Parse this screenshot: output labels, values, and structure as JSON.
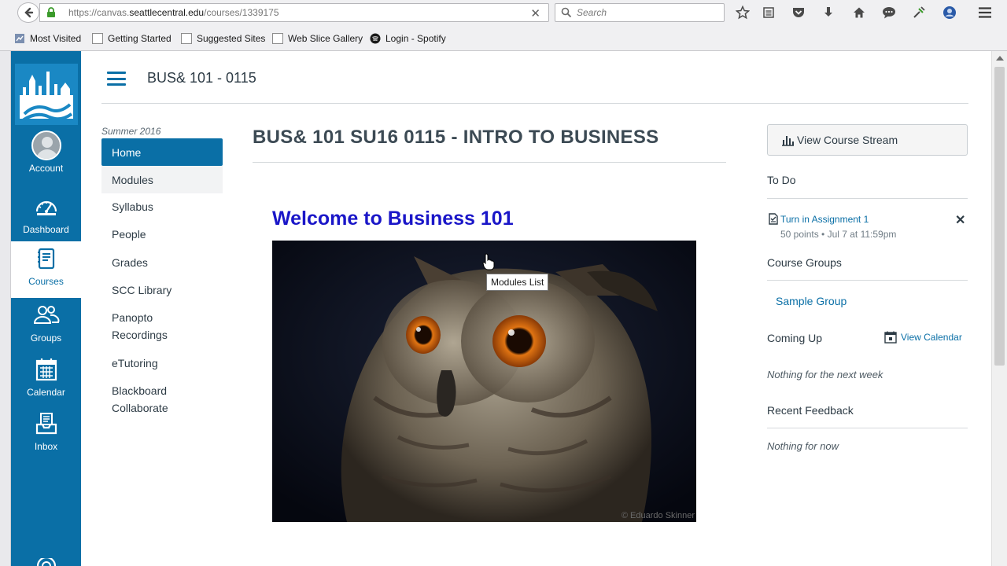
{
  "browser": {
    "url_prefix": "https://canvas.",
    "url_domain": "seattlecentral.edu",
    "url_path": "/courses/1339175",
    "search_placeholder": "Search",
    "bookmarks": [
      {
        "label": "Most Visited"
      },
      {
        "label": "Getting Started"
      },
      {
        "label": "Suggested Sites"
      },
      {
        "label": "Web Slice Gallery"
      },
      {
        "label": "Login - Spotify"
      }
    ]
  },
  "global_nav": {
    "items": [
      {
        "label": "Account",
        "icon": "avatar"
      },
      {
        "label": "Dashboard",
        "icon": "dashboard-icon"
      },
      {
        "label": "Courses",
        "icon": "courses-icon",
        "active": true
      },
      {
        "label": "Groups",
        "icon": "groups-icon"
      },
      {
        "label": "Calendar",
        "icon": "calendar-icon"
      },
      {
        "label": "Inbox",
        "icon": "inbox-icon"
      }
    ],
    "accent": "#0a6fa6"
  },
  "header": {
    "course_crumb": "BUS& 101 - 0115"
  },
  "course_nav": {
    "term": "Summer 2016",
    "items": [
      {
        "label": "Home"
      },
      {
        "label": "Modules"
      },
      {
        "label": "Syllabus"
      },
      {
        "label": "People"
      },
      {
        "label": "Grades"
      },
      {
        "label": "SCC Library"
      },
      {
        "label": "Panopto\nRecordings"
      },
      {
        "label": "eTutoring"
      },
      {
        "label": "Blackboard\nCollaborate"
      }
    ]
  },
  "main": {
    "course_title": "BUS& 101 SU16 0115 - INTRO TO BUSINESS",
    "welcome": "Welcome to Business 101",
    "image_credit": "© Eduardo Skinner",
    "tooltip": "Modules List"
  },
  "sidebar": {
    "stream_button": "View Course Stream",
    "todo_heading": "To Do",
    "todo_item": {
      "title": "Turn in Assignment 1",
      "meta": "50 points • Jul 7 at 11:59pm"
    },
    "groups_heading": "Course Groups",
    "group_link": "Sample Group",
    "coming_up_heading": "Coming Up",
    "calendar_link": "View Calendar",
    "coming_up_empty": "Nothing for the next week",
    "feedback_heading": "Recent Feedback",
    "feedback_empty": "Nothing for now"
  }
}
